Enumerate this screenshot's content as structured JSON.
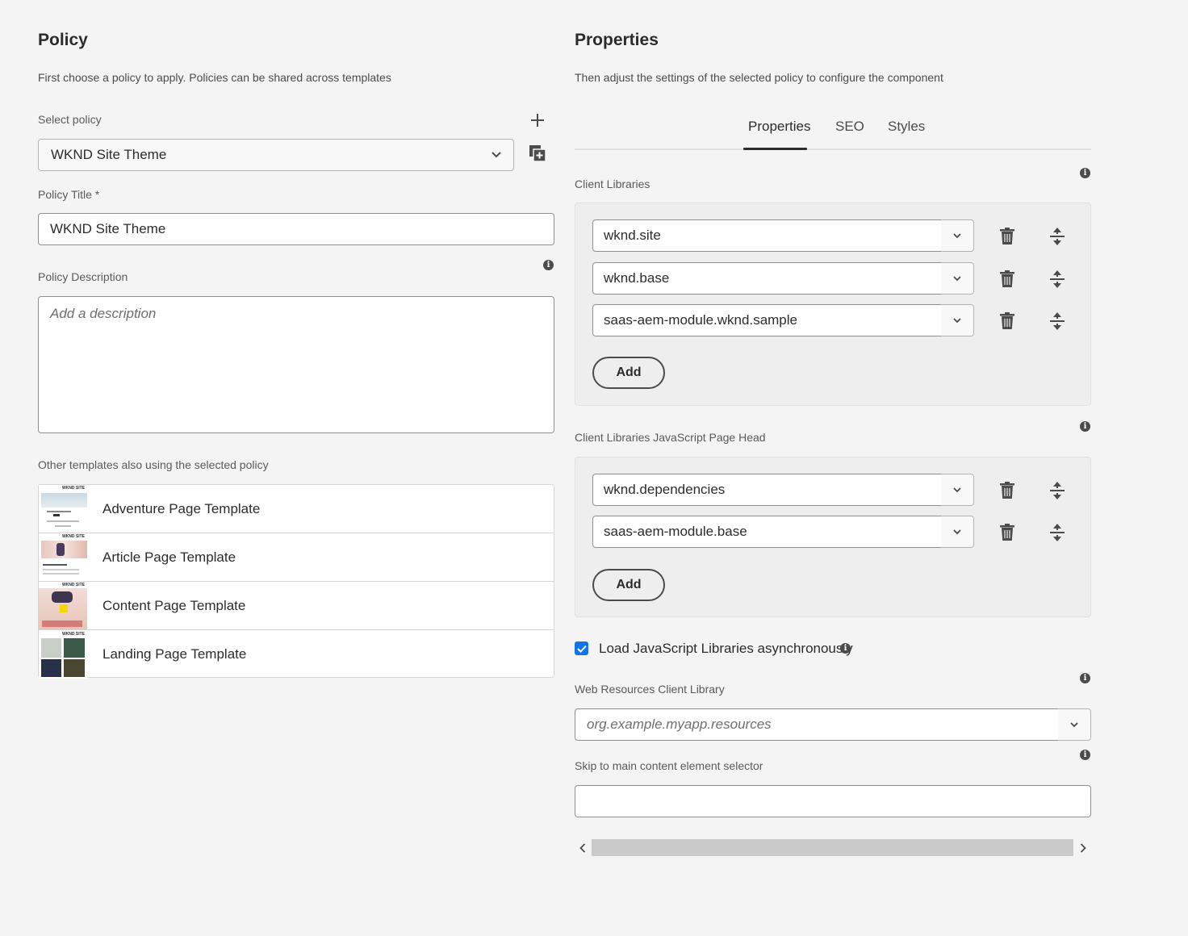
{
  "policy": {
    "title": "Policy",
    "description": "First choose a policy to apply. Policies can be shared across templates",
    "select_label": "Select policy",
    "selected_policy": "WKND Site Theme",
    "policy_title_label": "Policy Title *",
    "policy_title_value": "WKND Site Theme",
    "policy_description_label": "Policy Description",
    "policy_description_placeholder": "Add a description",
    "other_templates_label": "Other templates also using the selected policy",
    "templates": [
      {
        "name": "Adventure Page Template",
        "thumb_text": "WKND SITE"
      },
      {
        "name": "Article Page Template",
        "thumb_text": "WKND SITE"
      },
      {
        "name": "Content Page Template",
        "thumb_text": "WKND SITE"
      },
      {
        "name": "Landing Page Template",
        "thumb_text": "WKND SITE"
      }
    ]
  },
  "properties": {
    "title": "Properties",
    "description": "Then adjust the settings of the selected policy to configure the component",
    "tabs": [
      {
        "label": "Properties",
        "active": true
      },
      {
        "label": "SEO",
        "active": false
      },
      {
        "label": "Styles",
        "active": false
      }
    ],
    "client_libraries": {
      "label": "Client Libraries",
      "items": [
        "wknd.site",
        "wknd.base",
        "saas-aem-module.wknd.sample"
      ],
      "add_label": "Add"
    },
    "client_libraries_js_head": {
      "label": "Client Libraries JavaScript Page Head",
      "items": [
        "wknd.dependencies",
        "saas-aem-module.base"
      ],
      "add_label": "Add"
    },
    "load_async": {
      "label": "Load JavaScript Libraries asynchronously",
      "checked": true
    },
    "web_resources": {
      "label": "Web Resources Client Library",
      "placeholder": "org.example.myapp.resources"
    },
    "skip_to_main": {
      "label": "Skip to main content element selector",
      "value": ""
    }
  },
  "colors": {
    "accent_blue": "#1473e6",
    "background": "#f4f4f4",
    "text_primary": "#2c2c2c"
  },
  "icons": {
    "add": "plus-icon",
    "duplicate": "duplicate-icon",
    "info": "info-icon",
    "delete": "trash-icon",
    "reorder": "move-vertical-icon",
    "dropdown": "chevron-down-icon"
  }
}
